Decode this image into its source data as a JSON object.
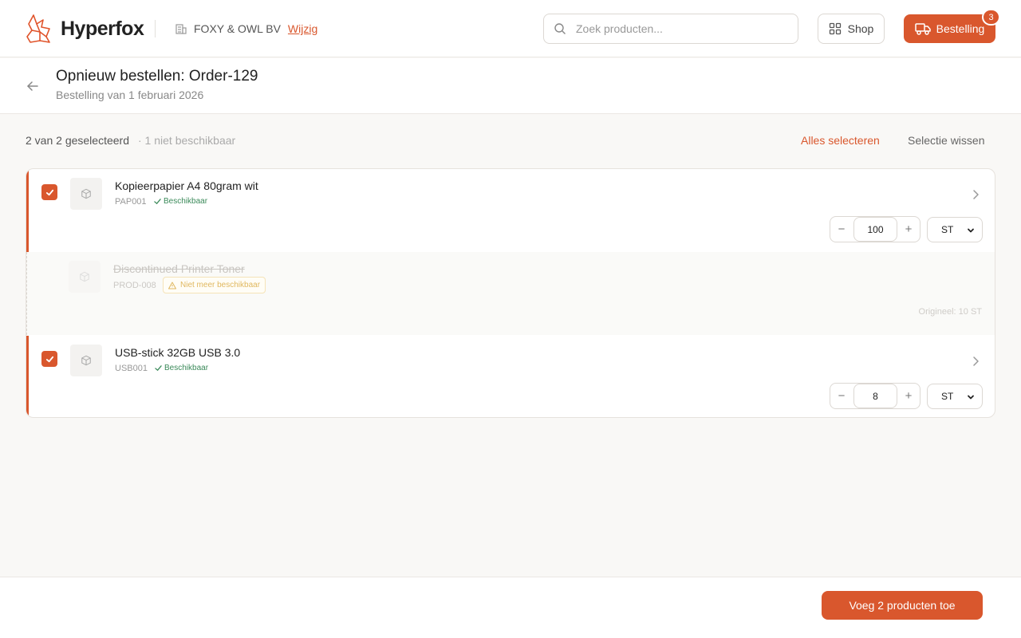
{
  "header": {
    "brand": "Hyperfox",
    "company": "FOXY & OWL BV",
    "change_link": "Wijzig",
    "search_placeholder": "Zoek producten...",
    "shop_label": "Shop",
    "order_label": "Bestelling",
    "order_count": "3"
  },
  "page": {
    "title": "Opnieuw bestellen: Order-129",
    "subtitle": "Bestelling van 1 februari 2026"
  },
  "selection": {
    "count_text": "2 van 2 geselecteerd",
    "unavailable_text": "· 1 niet beschikbaar",
    "select_all": "Alles selecteren",
    "clear": "Selectie wissen"
  },
  "items": [
    {
      "name": "Kopieerpapier A4 80gram wit",
      "sku": "PAP001",
      "status": "Beschikbaar",
      "quantity": "100",
      "unit": "ST",
      "checked": true
    },
    {
      "name": "Discontinued Printer Toner",
      "sku": "PROD-008",
      "status": "Niet meer beschikbaar",
      "original": "Origineel: 10 ST",
      "available": false
    },
    {
      "name": "USB-stick 32GB USB 3.0",
      "sku": "USB001",
      "status": "Beschikbaar",
      "quantity": "8",
      "unit": "ST",
      "checked": true
    }
  ],
  "footer": {
    "add_button": "Voeg 2 producten toe"
  },
  "colors": {
    "accent": "#d9572d",
    "available": "#3b8a5a",
    "warning": "#e0b85f"
  }
}
